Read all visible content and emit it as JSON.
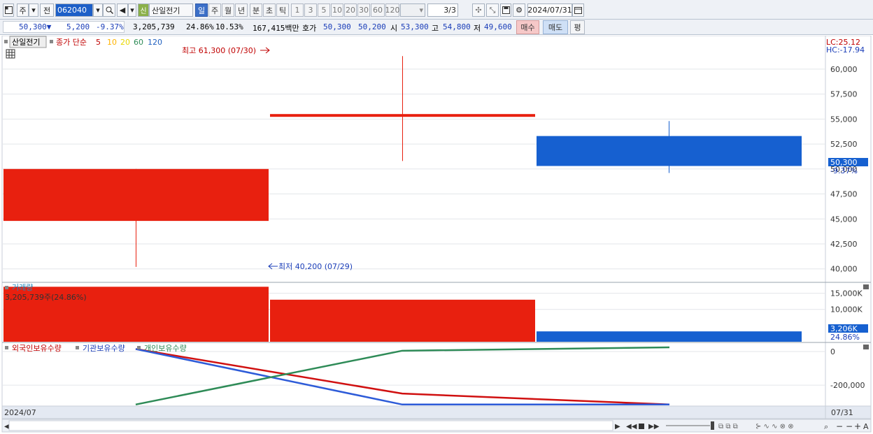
{
  "toolbar": {
    "type_label": "주",
    "prev_label": "전",
    "code": "062040",
    "stock_name": "산일전기",
    "new_badge": "신",
    "periods": [
      "일",
      "주",
      "월",
      "년",
      "분",
      "초",
      "틱"
    ],
    "numbers": [
      "1",
      "3",
      "5",
      "10",
      "20",
      "30",
      "60",
      "120"
    ],
    "page": "3/3",
    "date": "2024/07/31"
  },
  "info": {
    "price": "50,300▼",
    "change": "5,200",
    "rate": "-9.37%",
    "volume": "3,205,739",
    "vol_rate": "24.86%",
    "turnover": "10.53%",
    "amount": "167,415백만",
    "hoga_label": "호가",
    "hoga1": "50,300",
    "hoga2": "50,200",
    "open_label": "시",
    "open": "53,300",
    "high_label": "고",
    "high": "54,800",
    "low_label": "저",
    "low": "49,600",
    "buy_label": "매수",
    "sell_label": "매도",
    "eval_label": "평"
  },
  "chart": {
    "legend_name": "산일전기",
    "legend_ma": "종가 단순",
    "ma_periods": [
      "5",
      "10",
      "20",
      "60",
      "120"
    ],
    "ma_colors": [
      "#c00000",
      "#ffb300",
      "#e8d800",
      "#2e8b57",
      "#1f5fbf"
    ],
    "lc": "LC:25.12",
    "hc": "HC:-17.94",
    "high_note": "최고 61,300 (07/30)",
    "low_note": "최저 40,200 (07/29)",
    "current_price": "50,300",
    "current_rate": "-9.37%",
    "price_ticks": [
      "60,000",
      "57,500",
      "55,000",
      "52,500",
      "50,000",
      "47,500",
      "45,000",
      "42,500",
      "40,000"
    ],
    "volume_title": "거래량",
    "volume_note": "3,205,739주(24.86%)",
    "volume_ticks": [
      "15,000K",
      "10,000K"
    ],
    "volume_current": "3,206K",
    "volume_rate": "24.86%",
    "holder_legend": [
      "외국인보유수량",
      "기관보유수량",
      "개인보유수량"
    ],
    "holder_ticks": [
      "0",
      "-200,000"
    ],
    "x_left": "2024/07",
    "x_right": "07/31"
  },
  "chart_data": {
    "type": "candlestick",
    "dates": [
      "07/29",
      "07/30",
      "07/31"
    ],
    "price": {
      "ylim": [
        39000,
        63000
      ],
      "candles": [
        {
          "open": 50000,
          "close": 44800,
          "high": 50000,
          "low": 40200,
          "color": "#e8200f"
        },
        {
          "open": 55500,
          "close": 55300,
          "high": 61300,
          "low": 50800,
          "color": "#e8200f"
        },
        {
          "open": 53300,
          "close": 50300,
          "high": 54800,
          "low": 49600,
          "color": "#1660d0"
        }
      ]
    },
    "volume": {
      "ylim": [
        0,
        17500
      ],
      "values": [
        17000,
        13000,
        3206
      ],
      "colors": [
        "#e8200f",
        "#e8200f",
        "#1660d0"
      ]
    },
    "holdings": {
      "ylim": [
        -320000,
        50000
      ],
      "series": [
        {
          "name": "외국인보유수량",
          "color": "#d01010",
          "values": [
            15000,
            -250000,
            -315000
          ]
        },
        {
          "name": "기관보유수량",
          "color": "#2d5bd8",
          "values": [
            15000,
            -315000,
            -315000
          ]
        },
        {
          "name": "개인보유수량",
          "color": "#2e8b57",
          "values": [
            -315000,
            5000,
            25000
          ]
        }
      ]
    }
  }
}
